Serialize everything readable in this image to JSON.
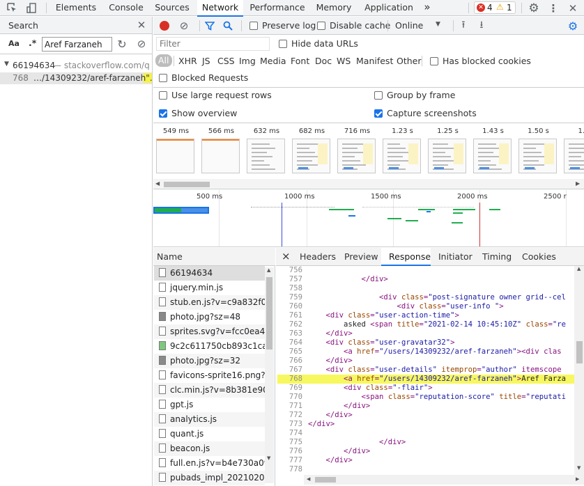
{
  "devtools": {
    "tabs": [
      "Elements",
      "Console",
      "Sources",
      "Network",
      "Performance",
      "Memory",
      "Application"
    ],
    "active_tab": "Network",
    "more_tabs": "»",
    "errors": "4",
    "warnings": "1"
  },
  "search": {
    "title": "Search",
    "case_label": "Aa",
    "regex_label": ".*",
    "query": "Aref Farzaneh",
    "result_id": "66194634",
    "result_source": "— stackoverflow.com/q...",
    "match_line": "768",
    "match_text": "…/14309232/aref-farzaneh\"…"
  },
  "network": {
    "preserve_log": "Preserve log",
    "disable_cache": "Disable cache",
    "throttle": "Online",
    "filter_placeholder": "Filter",
    "hide_data_urls": "Hide data URLs",
    "types": [
      "All",
      "XHR",
      "JS",
      "CSS",
      "Img",
      "Media",
      "Font",
      "Doc",
      "WS",
      "Manifest",
      "Other"
    ],
    "has_blocked_cookies": "Has blocked cookies",
    "blocked_requests": "Blocked Requests",
    "large_rows": "Use large request rows",
    "group_by_frame": "Group by frame",
    "show_overview": "Show overview",
    "capture_screenshots": "Capture screenshots"
  },
  "filmstrip": [
    "549 ms",
    "566 ms",
    "632 ms",
    "682 ms",
    "716 ms",
    "1.23 s",
    "1.25 s",
    "1.43 s",
    "1.50 s",
    "1.5"
  ],
  "overview_ticks": [
    "500 ms",
    "1000 ms",
    "1500 ms",
    "2000 ms",
    "2500 r"
  ],
  "name_header": "Name",
  "requests": [
    "66194634",
    "jquery.min.js",
    "stub.en.js?v=c9a832f098:",
    "photo.jpg?sz=48",
    "sprites.svg?v=fcc0ea44b..",
    "9c2c611750cb893c1ca3..",
    "photo.jpg?sz=32",
    "favicons-sprite16.png?v..",
    "clc.min.js?v=8b381e90b..",
    "gpt.js",
    "analytics.js",
    "quant.js",
    "beacon.js",
    "full.en.js?v=b4e730a0974",
    "pubads_impl_20210209.."
  ],
  "detail_tabs": [
    "Headers",
    "Preview",
    "Response",
    "Initiator",
    "Timing",
    "Cookies"
  ],
  "detail_active": "Response",
  "close_glyph": "×",
  "code_lines": [
    {
      "n": "756",
      "t": ""
    },
    {
      "n": "757",
      "t": "            </div>"
    },
    {
      "n": "758",
      "t": ""
    },
    {
      "n": "759",
      "t": "                <div class=\"post-signature owner grid--cel"
    },
    {
      "n": "760",
      "t": "                    <div class=\"user-info \">"
    },
    {
      "n": "761",
      "t": "    <div class=\"user-action-time\">"
    },
    {
      "n": "762",
      "t": "        asked <span title=\"2021-02-14 10:45:10Z\" class=\"re"
    },
    {
      "n": "763",
      "t": "    </div>"
    },
    {
      "n": "764",
      "t": "    <div class=\"user-gravatar32\">"
    },
    {
      "n": "765",
      "t": "        <a href=\"/users/14309232/aref-farzaneh\"><div clas"
    },
    {
      "n": "766",
      "t": "    </div>"
    },
    {
      "n": "767",
      "t": "    <div class=\"user-details\" itemprop=\"author\" itemscope"
    },
    {
      "n": "768",
      "t": "        <a href=\"/users/14309232/aref-farzaneh\">Aref Farza"
    },
    {
      "n": "769",
      "t": "        <div class=\"-flair\">"
    },
    {
      "n": "770",
      "t": "            <span class=\"reputation-score\" title=\"reputati"
    },
    {
      "n": "771",
      "t": "        </div>"
    },
    {
      "n": "772",
      "t": "    </div>"
    },
    {
      "n": "773",
      "t": "</div>"
    },
    {
      "n": "774",
      "t": ""
    },
    {
      "n": "775",
      "t": "                </div>"
    },
    {
      "n": "776",
      "t": "        </div>"
    },
    {
      "n": "777",
      "t": "    </div>"
    },
    {
      "n": "778",
      "t": ""
    },
    {
      "n": "779",
      "t": "    <div"
    }
  ],
  "highlight_line": "768"
}
